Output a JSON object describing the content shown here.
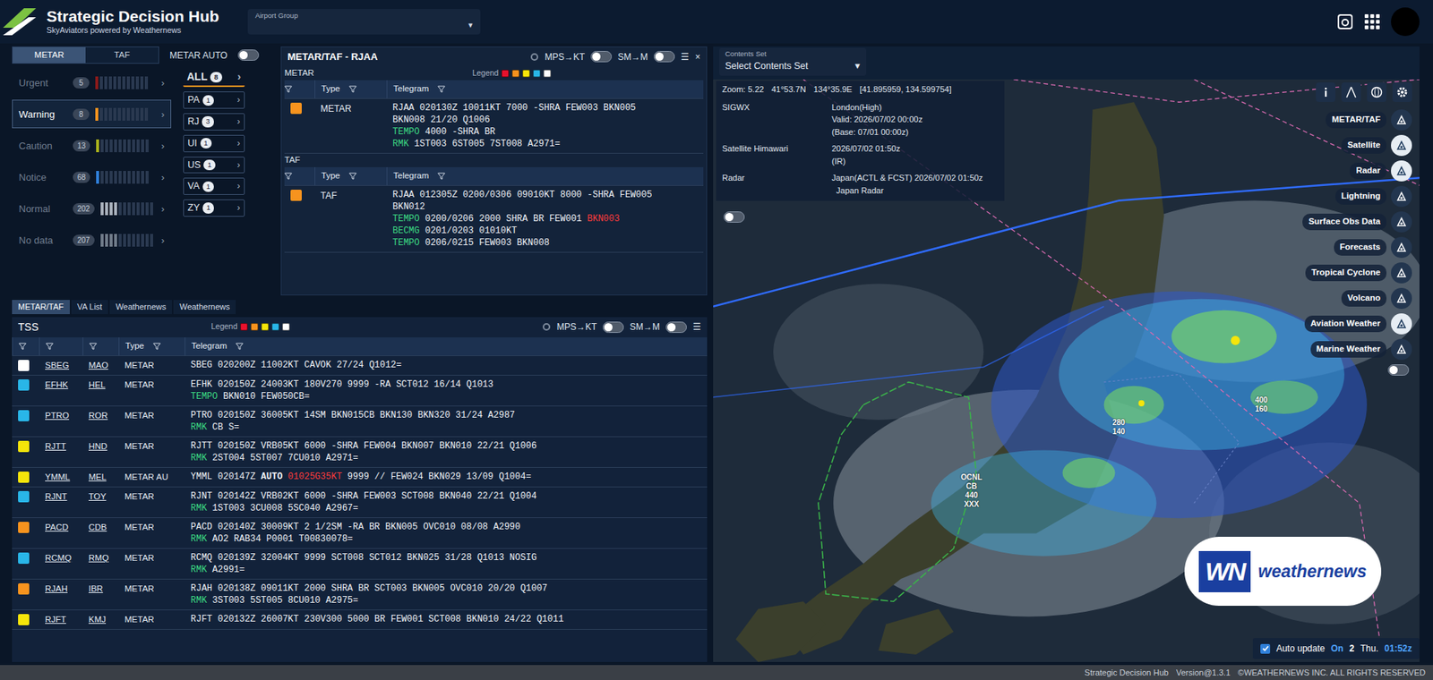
{
  "header": {
    "title": "Strategic Decision Hub",
    "subtitle": "SkyAviators powered by Weathernews",
    "airport_group": {
      "label": "Airport Group",
      "arrow": "▾"
    }
  },
  "left_tabs": [
    {
      "label": "METAR",
      "selected": true
    },
    {
      "label": "TAF",
      "selected": false
    }
  ],
  "metar_auto": {
    "label": "METAR AUTO",
    "on": false
  },
  "severity": [
    {
      "label": "Urgent",
      "count": "5",
      "arrow": "›",
      "level": 0.08,
      "color": "#8a1a1a",
      "selected": false
    },
    {
      "label": "Warning",
      "count": "8",
      "arrow": "›",
      "level": 0.08,
      "color": "#f7931e",
      "selected": true
    },
    {
      "label": "Caution",
      "count": "13",
      "arrow": "›",
      "level": 0.08,
      "color": "#a9b21c",
      "selected": false
    },
    {
      "label": "Notice",
      "count": "68",
      "arrow": "›",
      "level": 0.08,
      "color": "#2f7fd9",
      "selected": false
    },
    {
      "label": "Normal",
      "count": "202",
      "arrow": "›",
      "level": 0.33,
      "color": "#a8b0bb",
      "selected": false
    },
    {
      "label": "No data",
      "count": "207",
      "arrow": "›",
      "level": 0.33,
      "color": "#6f7a88",
      "selected": false
    }
  ],
  "groups": [
    {
      "label": "ALL",
      "count": "8",
      "arrow": "›",
      "selected": true
    },
    {
      "label": "PA",
      "count": "1",
      "arrow": "›",
      "selected": false
    },
    {
      "label": "RJ",
      "count": "3",
      "arrow": "›",
      "selected": false
    },
    {
      "label": "UI",
      "count": "1",
      "arrow": "›",
      "selected": false
    },
    {
      "label": "US",
      "count": "1",
      "arrow": "›",
      "selected": false
    },
    {
      "label": "VA",
      "count": "1",
      "arrow": "›",
      "selected": false
    },
    {
      "label": "ZY",
      "count": "1",
      "arrow": "›",
      "selected": false
    }
  ],
  "station_panel": {
    "title": "METAR/TAF - RJAA",
    "toggles": [
      {
        "label": "MPS→KT",
        "on": false
      },
      {
        "label": "SM→M",
        "on": false
      }
    ],
    "menu": "☰",
    "close": "×",
    "legend": {
      "label": "Legend",
      "colors": [
        "#e8112d",
        "#f7931e",
        "#f5e50a",
        "#29b6e8",
        "#ffffff"
      ]
    },
    "sections": [
      {
        "label": "METAR",
        "columns": [
          "Type",
          "Telegram"
        ],
        "rows": [
          {
            "color": "#f7931e",
            "type": "METAR",
            "lines": [
              [
                {
                  "text": "RJAA 020130Z 10011KT 7000 -SHRA FEW003 BKN005",
                  "kind": "plain"
                }
              ],
              [
                {
                  "text": "BKN008 21/20 Q1006",
                  "kind": "plain"
                }
              ],
              [
                {
                  "text": "TEMPO",
                  "kind": "group"
                },
                {
                  "text": "4000 -SHRA BR",
                  "kind": "plain"
                }
              ],
              [
                {
                  "text": "RMK",
                  "kind": "group"
                },
                {
                  "text": "1ST003 6ST005 7ST008 A2971=",
                  "kind": "plain"
                }
              ]
            ]
          }
        ]
      },
      {
        "label": "TAF",
        "columns": [
          "Type",
          "Telegram"
        ],
        "rows": [
          {
            "color": "#f7931e",
            "type": "TAF",
            "lines": [
              [
                {
                  "text": "RJAA 012305Z 0200/0306 09010KT 8000 -SHRA FEW005",
                  "kind": "plain"
                }
              ],
              [
                {
                  "text": "BKN012",
                  "kind": "plain"
                }
              ],
              [
                {
                  "text": "TEMPO",
                  "kind": "group"
                },
                {
                  "text": "0200/0206 2000 SHRA BR FEW001",
                  "kind": "plain"
                },
                {
                  "text": "BKN003",
                  "kind": "alert"
                }
              ],
              [
                {
                  "text": "BECMG",
                  "kind": "group"
                },
                {
                  "text": "0201/0203 01010KT",
                  "kind": "plain"
                }
              ],
              [
                {
                  "text": "TEMPO",
                  "kind": "group"
                },
                {
                  "text": "0206/0215 FEW003 BKN008",
                  "kind": "plain"
                }
              ]
            ]
          }
        ]
      }
    ]
  },
  "bottom_tabs": [
    {
      "label": "METAR/TAF",
      "selected": true
    },
    {
      "label": "VA List",
      "selected": false
    },
    {
      "label": "Weathernews",
      "selected": false
    },
    {
      "label": "Weathernews",
      "selected": false
    }
  ],
  "tss": {
    "title": "TSS",
    "legend": {
      "label": "Legend",
      "colors": [
        "#e8112d",
        "#f7931e",
        "#f5e50a",
        "#29b6e8",
        "#ffffff"
      ]
    },
    "toggles": [
      {
        "label": "MPS→KT",
        "on": false
      },
      {
        "label": "SM→M",
        "on": false
      }
    ],
    "menu": "☰",
    "columns": [
      "Type",
      "Telegram"
    ],
    "rows": [
      {
        "color": "#ffffff",
        "icao": "SBEG",
        "iata": "MAO",
        "type": "METAR",
        "lines": [
          [
            {
              "text": "SBEG 020200Z 11002KT CAVOK 27/24 Q1012=",
              "kind": "plain"
            }
          ]
        ]
      },
      {
        "color": "#29b6e8",
        "icao": "EFHK",
        "iata": "HEL",
        "type": "METAR",
        "lines": [
          [
            {
              "text": "EFHK 020150Z 24003KT 180V270 9999 -RA SCT012 16/14 Q1013",
              "kind": "plain"
            }
          ],
          [
            {
              "text": "TEMPO",
              "kind": "group"
            },
            {
              "text": "BKN010 FEW050CB=",
              "kind": "plain"
            }
          ]
        ]
      },
      {
        "color": "#29b6e8",
        "icao": "PTRO",
        "iata": "ROR",
        "type": "METAR",
        "lines": [
          [
            {
              "text": "PTRO 020150Z 36005KT 14SM BKN015CB BKN130 BKN320 31/24 A2987",
              "kind": "plain"
            }
          ],
          [
            {
              "text": "RMK",
              "kind": "group"
            },
            {
              "text": "CB S=",
              "kind": "plain"
            }
          ]
        ]
      },
      {
        "color": "#f5e50a",
        "icao": "RJTT",
        "iata": "HND",
        "type": "METAR",
        "lines": [
          [
            {
              "text": "RJTT 020150Z VRB05KT 6000 -SHRA FEW004 BKN007 BKN010 22/21 Q1006",
              "kind": "plain"
            }
          ],
          [
            {
              "text": "RMK",
              "kind": "group"
            },
            {
              "text": "2ST004 5ST007 7CU010 A2971=",
              "kind": "plain"
            }
          ]
        ]
      },
      {
        "color": "#f5e50a",
        "icao": "YMML",
        "iata": "MEL",
        "type": "METAR AU",
        "lines": [
          [
            {
              "text": "YMML 020147Z",
              "kind": "plain"
            },
            {
              "text": "AUTO",
              "kind": "bold"
            },
            {
              "text": "01025G35KT",
              "kind": "alert"
            },
            {
              "text": "9999 // FEW024 BKN029 13/09 Q1004=",
              "kind": "plain"
            }
          ]
        ]
      },
      {
        "color": "#29b6e8",
        "icao": "RJNT",
        "iata": "TOY",
        "type": "METAR",
        "lines": [
          [
            {
              "text": "RJNT 020142Z VRB02KT 6000 -SHRA FEW003 SCT008 BKN040 22/21 Q1004",
              "kind": "plain"
            }
          ],
          [
            {
              "text": "RMK",
              "kind": "group"
            },
            {
              "text": "1ST003 3CU008 5SC040 A2967=",
              "kind": "plain"
            }
          ]
        ]
      },
      {
        "color": "#f7931e",
        "icao": "PACD",
        "iata": "CDB",
        "type": "METAR",
        "lines": [
          [
            {
              "text": "PACD 020140Z 30009KT 2 1/2SM -RA BR BKN005 OVC010 08/08 A2990",
              "kind": "plain"
            }
          ],
          [
            {
              "text": "RMK",
              "kind": "group"
            },
            {
              "text": "AO2 RAB34 P0001 T00830078=",
              "kind": "plain"
            }
          ]
        ]
      },
      {
        "color": "#29b6e8",
        "icao": "RCMQ",
        "iata": "RMQ",
        "type": "METAR",
        "lines": [
          [
            {
              "text": "RCMQ 020139Z 32004KT 9999 SCT008 SCT012 BKN025 31/28 Q1013 NOSIG",
              "kind": "plain"
            }
          ],
          [
            {
              "text": "RMK",
              "kind": "group"
            },
            {
              "text": "A2991=",
              "kind": "plain"
            }
          ]
        ]
      },
      {
        "color": "#f7931e",
        "icao": "RJAH",
        "iata": "IBR",
        "type": "METAR",
        "lines": [
          [
            {
              "text": "RJAH 020138Z 09011KT 2000 SHRA BR SCT003 BKN005 OVC010 20/20 Q1007",
              "kind": "plain"
            }
          ],
          [
            {
              "text": "RMK",
              "kind": "group"
            },
            {
              "text": "3ST003 5ST005 8CU010 A2975=",
              "kind": "plain"
            }
          ]
        ]
      },
      {
        "color": "#f5e50a",
        "icao": "RJFT",
        "iata": "KMJ",
        "type": "METAR",
        "lines": [
          [
            {
              "text": "RJFT 020132Z 26007KT 230V300 5000 BR FEW001 SCT008 BKN010 24/22 Q1011",
              "kind": "plain"
            }
          ]
        ]
      }
    ]
  },
  "map": {
    "contents_set": {
      "label": "Contents Set",
      "placeholder": "Select Contents Set",
      "arrow": "▾"
    },
    "info": {
      "zoom": "Zoom: 5.22",
      "lat": "41°53.7N",
      "lon": "134°35.9E",
      "coords": "[41.895959, 134.599754]"
    },
    "layers_info": [
      {
        "name": "SIGWX",
        "lines": [
          "London(High)",
          "Valid: 2026/07/02 00:00z",
          "(Base: 07/01 00:00z)"
        ]
      },
      {
        "name": "Satellite Himawari",
        "lines": [
          "2026/07/02 01:50z",
          "(IR)"
        ]
      },
      {
        "name": "Radar",
        "lines": [
          "Japan(ACTL & FCST) 2026/07/02 01:50z",
          "  Japan Radar"
        ]
      }
    ],
    "info_toggle_on": false,
    "layer_buttons": [
      {
        "label": "METAR/TAF",
        "on": false
      },
      {
        "label": "Satellite",
        "on": true
      },
      {
        "label": "Radar",
        "on": true
      },
      {
        "label": "Lightning",
        "on": false
      },
      {
        "label": "Surface Obs Data",
        "on": false
      },
      {
        "label": "Forecasts",
        "on": false
      },
      {
        "label": "Tropical Cyclone",
        "on": false
      },
      {
        "label": "Volcano",
        "on": false
      },
      {
        "label": "Aviation Weather",
        "on": true
      },
      {
        "label": "Marine Weather",
        "on": false
      }
    ],
    "layers_toggle_on": false,
    "labels": [
      {
        "lines": [
          "OCNL",
          "CB",
          "440",
          "XXX"
        ]
      },
      {
        "lines": [
          "280",
          "140"
        ]
      },
      {
        "lines": [
          "400",
          "160"
        ]
      }
    ],
    "logo": {
      "mark": "WN",
      "text": "weathernews"
    },
    "auto_update": {
      "checked": true,
      "label": "Auto update",
      "state": "On",
      "day": "2",
      "weekday": "Thu.",
      "time": "01:52z"
    }
  },
  "footer": {
    "app": "Strategic Decision Hub",
    "version": "Version@1.3.1",
    "copyright": "©WEATHERNEWS INC. ALL RIGHTS RESERVED"
  }
}
